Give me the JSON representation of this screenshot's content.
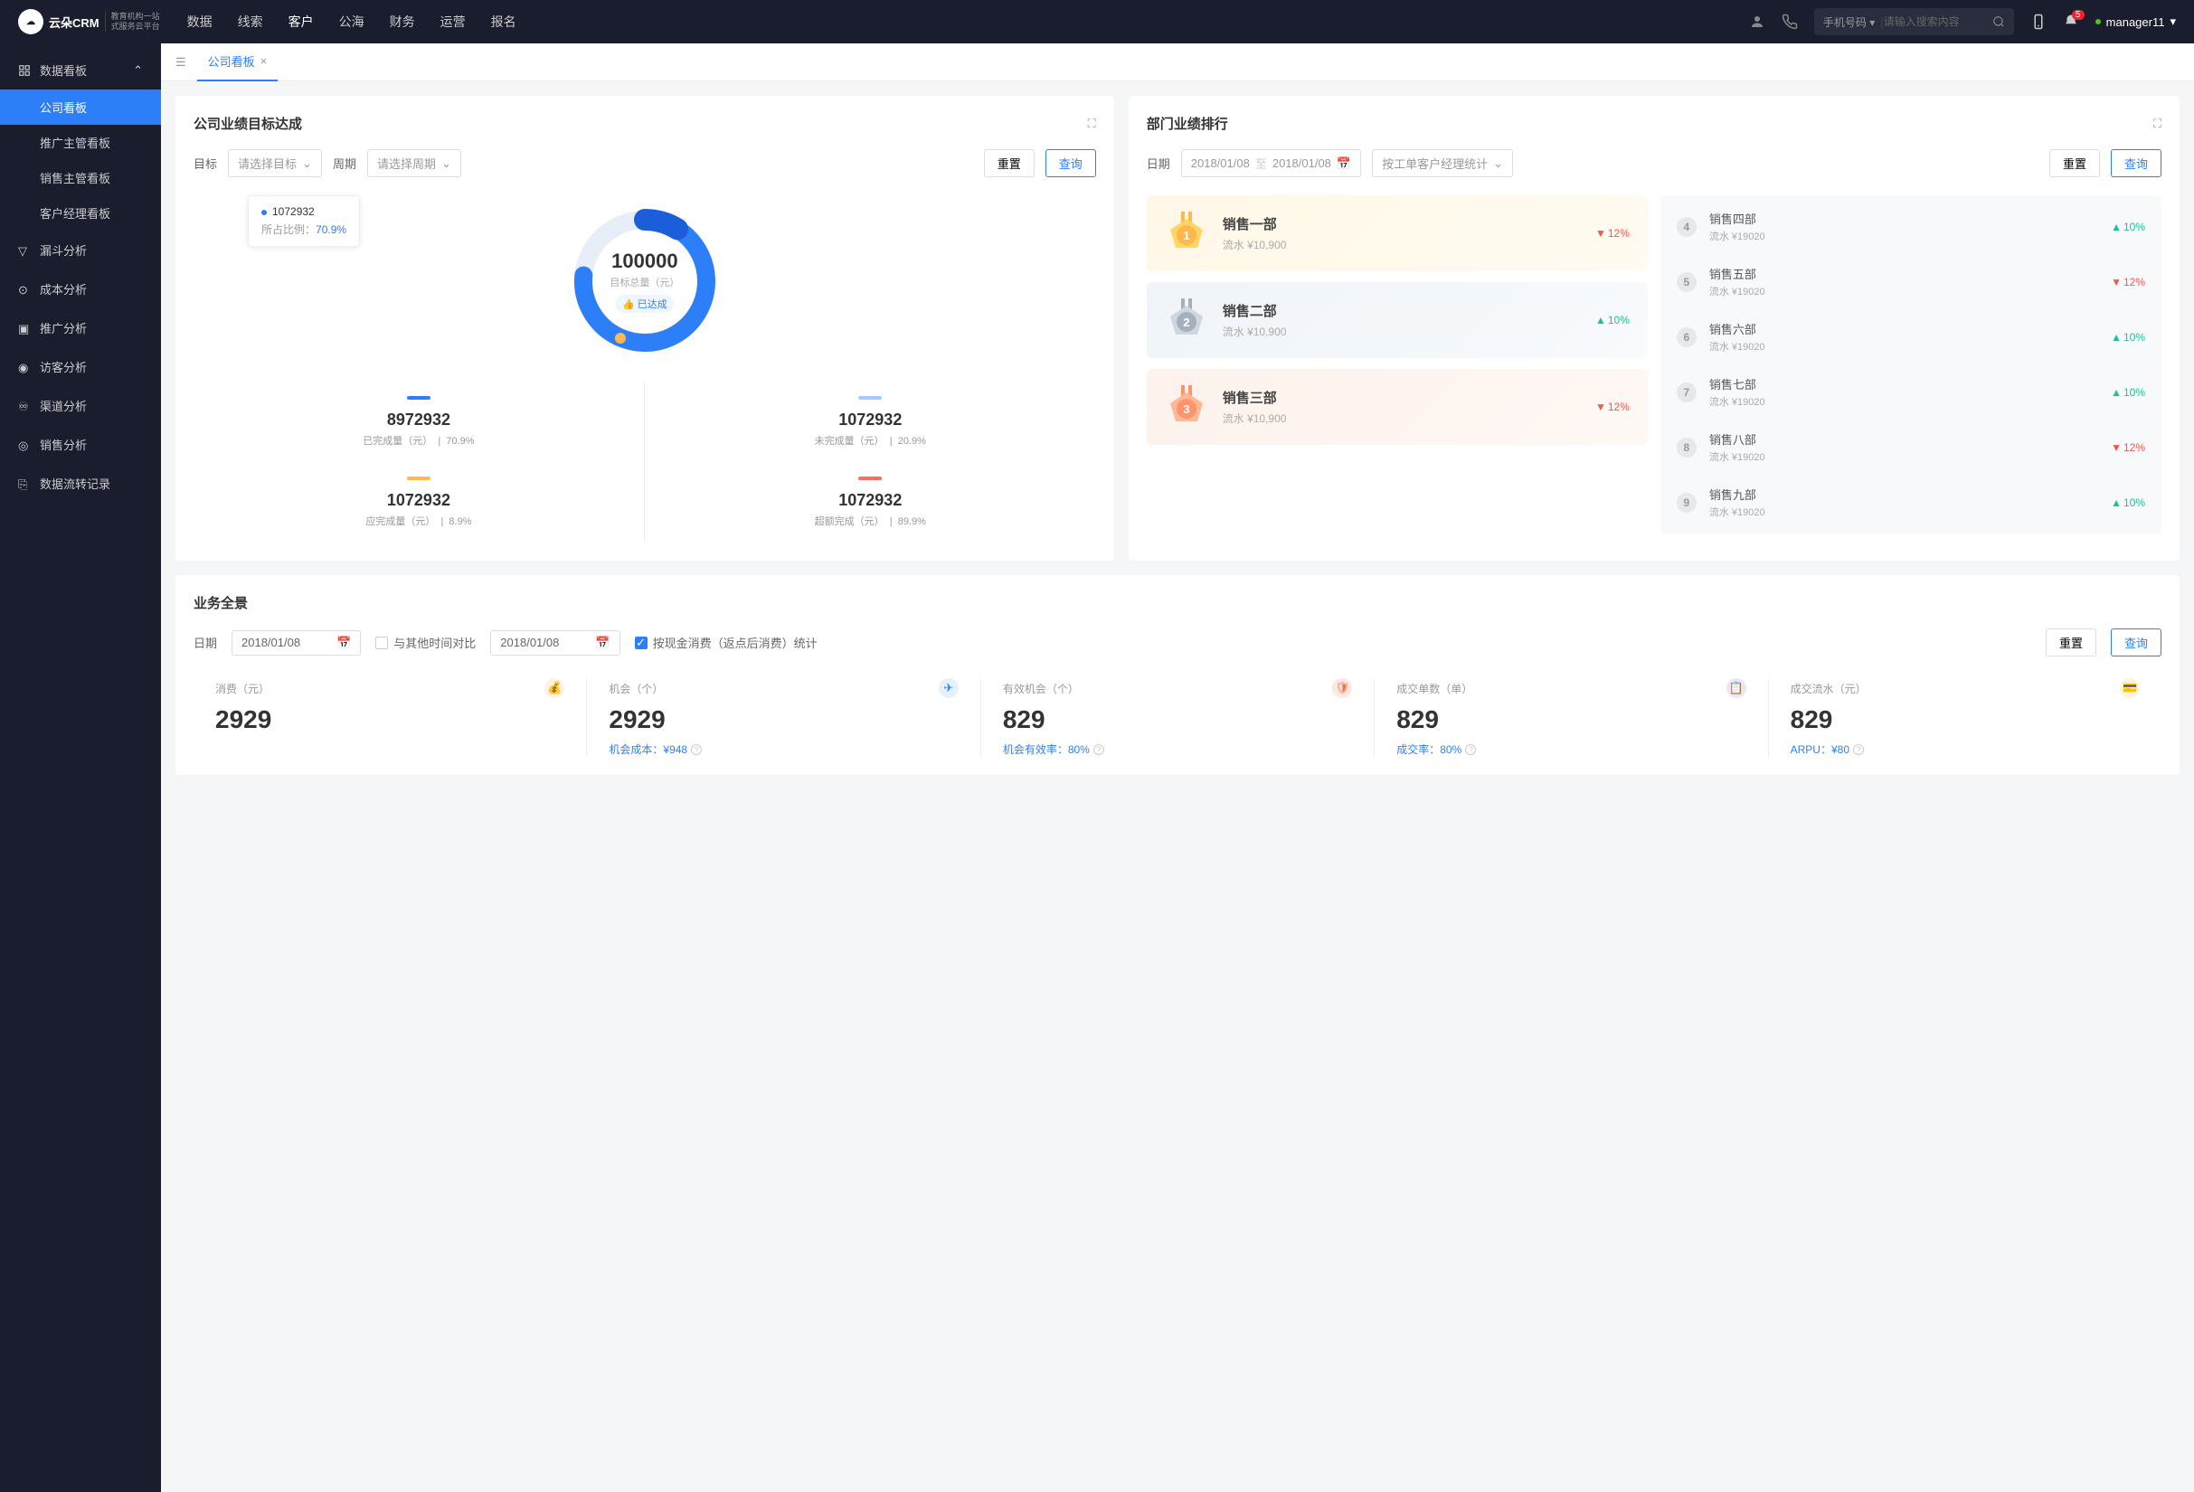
{
  "header": {
    "logo_main": "云朵CRM",
    "logo_sub1": "教育机构一站",
    "logo_sub2": "式服务云平台",
    "nav": [
      "数据",
      "线索",
      "客户",
      "公海",
      "财务",
      "运营",
      "报名"
    ],
    "active_nav": "客户",
    "search_type": "手机号码",
    "search_placeholder": "请输入搜索内容",
    "badge": "5",
    "user": "manager11"
  },
  "sidebar": {
    "section": "数据看板",
    "subs": [
      "公司看板",
      "推广主管看板",
      "销售主管看板",
      "客户经理看板"
    ],
    "active_sub": "公司看板",
    "items": [
      "漏斗分析",
      "成本分析",
      "推广分析",
      "访客分析",
      "渠道分析",
      "销售分析",
      "数据流转记录"
    ]
  },
  "tabs": {
    "current": "公司看板"
  },
  "goal_panel": {
    "title": "公司业绩目标达成",
    "label_target": "目标",
    "select_target": "请选择目标",
    "label_period": "周期",
    "select_period": "请选择周期",
    "btn_reset": "重置",
    "btn_query": "查询",
    "tooltip_val": "1072932",
    "tooltip_pct_label": "所占比例：",
    "tooltip_pct": "70.9%",
    "center_val": "100000",
    "center_label": "目标总量（元）",
    "center_badge": "已达成",
    "stats": [
      {
        "bar": "#2d7ff9",
        "val": "8972932",
        "label": "已完成量（元）",
        "pct": "70.9%"
      },
      {
        "bar": "#a6c8ff",
        "val": "1072932",
        "label": "未完成量（元）",
        "pct": "20.9%"
      },
      {
        "bar": "#ffb84d",
        "val": "1072932",
        "label": "应完成量（元）",
        "pct": "8.9%"
      },
      {
        "bar": "#ff6b5c",
        "val": "1072932",
        "label": "超额完成（元）",
        "pct": "89.9%"
      }
    ]
  },
  "rank_panel": {
    "title": "部门业绩排行",
    "label_date": "日期",
    "date_from": "2018/01/08",
    "date_sep": "至",
    "date_to": "2018/01/08",
    "stat_by": "按工单客户经理统计",
    "btn_reset": "重置",
    "btn_query": "查询",
    "top3": [
      {
        "rank": "1",
        "name": "销售一部",
        "sub": "流水 ¥10,900",
        "pct": "12%",
        "dir": "down"
      },
      {
        "rank": "2",
        "name": "销售二部",
        "sub": "流水 ¥10,900",
        "pct": "10%",
        "dir": "up"
      },
      {
        "rank": "3",
        "name": "销售三部",
        "sub": "流水 ¥10,900",
        "pct": "12%",
        "dir": "down"
      }
    ],
    "rest": [
      {
        "rank": "4",
        "name": "销售四部",
        "sub": "流水 ¥19020",
        "pct": "10%",
        "dir": "up"
      },
      {
        "rank": "5",
        "name": "销售五部",
        "sub": "流水 ¥19020",
        "pct": "12%",
        "dir": "down"
      },
      {
        "rank": "6",
        "name": "销售六部",
        "sub": "流水 ¥19020",
        "pct": "10%",
        "dir": "up"
      },
      {
        "rank": "7",
        "name": "销售七部",
        "sub": "流水 ¥19020",
        "pct": "10%",
        "dir": "up"
      },
      {
        "rank": "8",
        "name": "销售八部",
        "sub": "流水 ¥19020",
        "pct": "12%",
        "dir": "down"
      },
      {
        "rank": "9",
        "name": "销售九部",
        "sub": "流水 ¥19020",
        "pct": "10%",
        "dir": "up"
      }
    ]
  },
  "overview_panel": {
    "title": "业务全景",
    "label_date": "日期",
    "date1": "2018/01/08",
    "compare_label": "与其他时间对比",
    "date2": "2018/01/08",
    "checkbox_label": "按现金消费（返点后消费）统计",
    "btn_reset": "重置",
    "btn_query": "查询",
    "kpis": [
      {
        "label": "消费（元）",
        "val": "2929",
        "sub": "",
        "icon_bg": "#fff2e0",
        "icon_color": "#ffa940"
      },
      {
        "label": "机会（个）",
        "val": "2929",
        "sub": "机会成本：¥948",
        "icon_bg": "#e6f0ff",
        "icon_color": "#2d7ff9"
      },
      {
        "label": "有效机会（个）",
        "val": "829",
        "sub": "机会有效率：80%",
        "icon_bg": "#ffe8e0",
        "icon_color": "#ff6b3d"
      },
      {
        "label": "成交单数（单）",
        "val": "829",
        "sub": "成交率：80%",
        "icon_bg": "#e8e6ff",
        "icon_color": "#6557ff"
      },
      {
        "label": "成交流水（元）",
        "val": "829",
        "sub": "ARPU：¥80",
        "icon_bg": "#fff4d9",
        "icon_color": "#ffb84d"
      }
    ]
  },
  "chart_data": {
    "type": "pie",
    "title": "公司业绩目标达成",
    "total_label": "目标总量（元）",
    "total": 100000,
    "series": [
      {
        "name": "已完成量（元）",
        "value": 8972932,
        "pct": 70.9,
        "color": "#2d7ff9"
      },
      {
        "name": "未完成量（元）",
        "value": 1072932,
        "pct": 20.9,
        "color": "#a6c8ff"
      },
      {
        "name": "应完成量（元）",
        "value": 1072932,
        "pct": 8.9,
        "color": "#ffb84d"
      },
      {
        "name": "超额完成（元）",
        "value": 1072932,
        "pct": 89.9,
        "color": "#ff6b5c"
      }
    ],
    "highlight": {
      "value": 1072932,
      "pct": 70.9
    }
  }
}
